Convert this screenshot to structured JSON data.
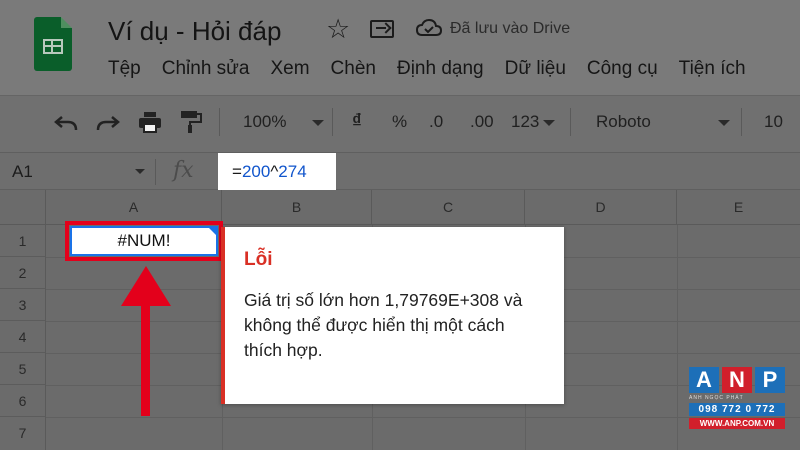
{
  "header": {
    "title": "Ví dụ - Hỏi đáp",
    "save_status": "Đã lưu vào Drive"
  },
  "menu": [
    "Tệp",
    "Chỉnh sửa",
    "Xem",
    "Chèn",
    "Định dạng",
    "Dữ liệu",
    "Công cụ",
    "Tiện ích"
  ],
  "toolbar": {
    "zoom": "100%",
    "currency": "₫",
    "percent": "%",
    "decimal_decrease": ".0",
    "decimal_increase": ".00",
    "number_format": "123",
    "font": "Roboto",
    "font_size": "10"
  },
  "formula_bar": {
    "cell_ref": "A1",
    "fx": "fx",
    "formula_prefix": "=",
    "formula_base": "200",
    "formula_op": "^",
    "formula_exp": "274"
  },
  "grid": {
    "columns": [
      "A",
      "B",
      "C",
      "D",
      "E"
    ],
    "rows": [
      "1",
      "2",
      "3",
      "4",
      "5",
      "6",
      "7"
    ],
    "a1_value": "#NUM!"
  },
  "error_popup": {
    "title": "Lỗi",
    "message": "Giá trị số lớn hơn 1,79769E+308 và không thể được hiển thị một cách thích hợp."
  },
  "watermark": {
    "letters": [
      "A",
      "N",
      "P"
    ],
    "tagline": "ANH NGỌC PHÁT",
    "phone": "098 772 0 772",
    "website": "WWW.ANP.COM.VN",
    "colors": [
      "#1d6fb8",
      "#d11f2b",
      "#1d6fb8"
    ]
  }
}
